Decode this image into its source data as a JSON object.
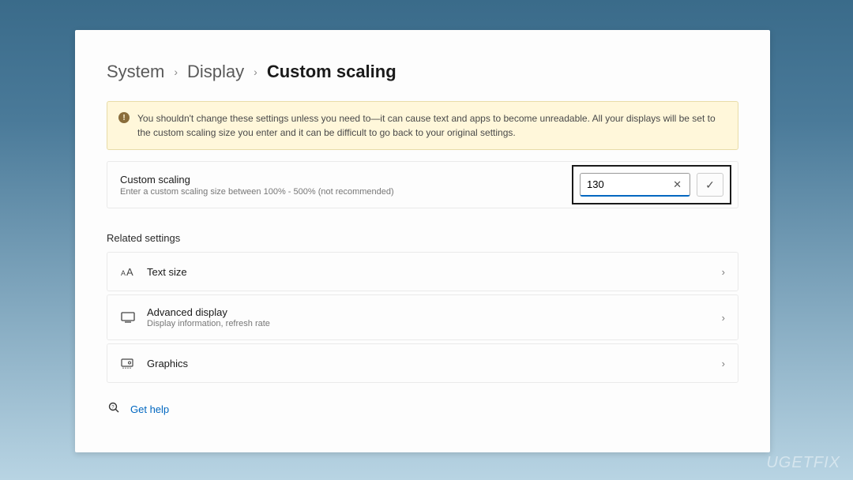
{
  "breadcrumb": {
    "part1": "System",
    "part2": "Display",
    "current": "Custom scaling"
  },
  "warning": {
    "text": "You shouldn't change these settings unless you need to—it can cause text and apps to become unreadable. All your displays will be set to the custom scaling size you enter and it can be difficult to go back to your original settings."
  },
  "custom": {
    "title": "Custom scaling",
    "sub": "Enter a custom scaling size between 100% - 500% (not recommended)",
    "value": "130"
  },
  "section": {
    "label": "Related settings"
  },
  "rows": {
    "text_size": {
      "title": "Text size"
    },
    "advanced": {
      "title": "Advanced display",
      "sub": "Display information, refresh rate"
    },
    "graphics": {
      "title": "Graphics"
    }
  },
  "help": {
    "label": "Get help"
  },
  "watermark": "UGETFIX"
}
